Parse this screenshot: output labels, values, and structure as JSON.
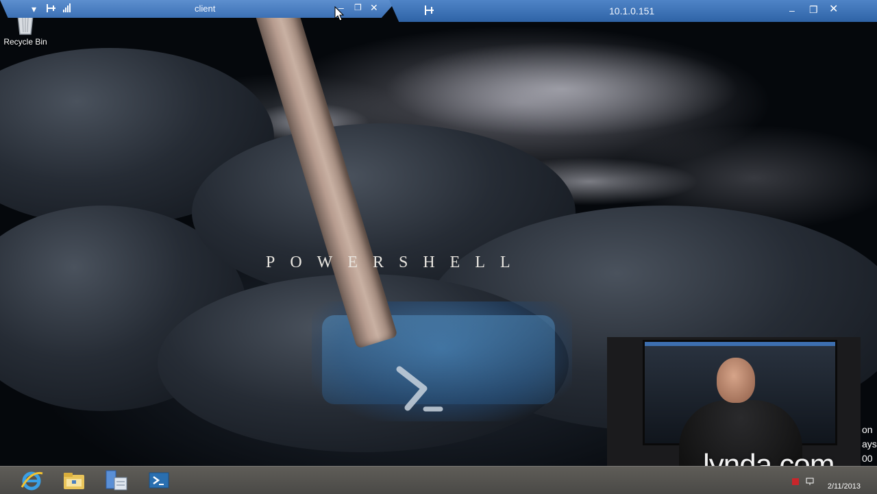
{
  "desktop": {
    "recycle_bin_label": "Recycle Bin",
    "wallpaper_brand": "POWERSHELL"
  },
  "client_bar": {
    "title": "client",
    "icons": [
      "chevron-down-icon",
      "pin-icon",
      "signal-icon",
      "minimize-icon",
      "restore-icon",
      "close-icon"
    ]
  },
  "remote_bar": {
    "title": "10.1.0.151",
    "icons": [
      "pin-icon",
      "minimize-icon",
      "restore-icon",
      "close-icon"
    ]
  },
  "taskbar": {
    "apps": [
      "internet-explorer-icon",
      "file-explorer-icon",
      "server-manager-icon",
      "powershell-icon"
    ],
    "date": "2/11/2013"
  },
  "overlay": {
    "logo": "lynda.com",
    "side_fragments": [
      "on",
      "ays",
      "00"
    ]
  },
  "colors": {
    "titlebar": "#3c70b4",
    "taskbar": "#4f4e4b",
    "powershell_blue": "#2a6fb0"
  }
}
